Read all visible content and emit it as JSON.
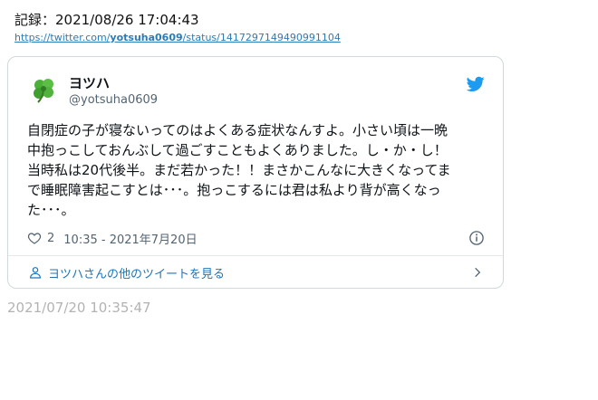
{
  "record": {
    "text": "記録：2021/08/26 17:04:43"
  },
  "url": {
    "prefix": "https://twitter.com/",
    "user": "yotsuha0609",
    "suffix": "/status/1417297149490991104"
  },
  "tweet": {
    "author_name": "ヨツハ",
    "author_handle": "@yotsuha0609",
    "avatar_icon": "four-leaf-clover-icon",
    "text": "自閉症の子が寝ないってのはよくある症状なんすよ。小さい頃は一晩\n中抱っこしておんぶして過ごすこともよくありました。し・か・し！\n当時私は20代後半。まだ若かった！！まさかこんなに大きくなってま\nで睡眠障害起こすとは･･･。抱っこするには君は私より背が高くなっ\nた･･･。",
    "likes": "2",
    "timestamp": "10:35 - 2021年7月20日",
    "more_link": "ヨツハさんの他のツイートを見る"
  },
  "footer": {
    "timestamp": "2021/07/20 10:35:47"
  },
  "colors": {
    "link": "#2b7bb9",
    "twitter_blue": "#1d9bf0",
    "muted": "#536471",
    "border": "#cfd9de"
  }
}
